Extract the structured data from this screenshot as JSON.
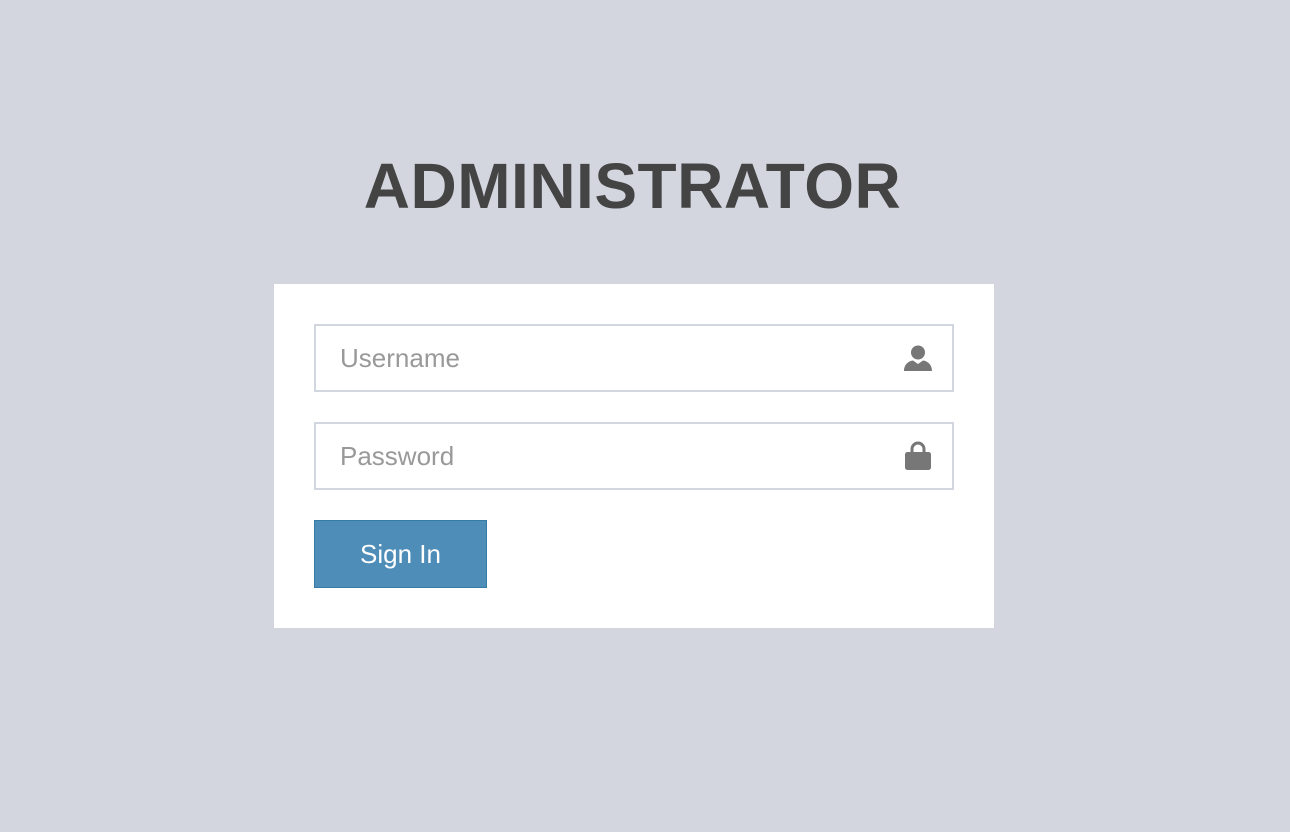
{
  "page": {
    "title": "ADMINISTRATOR"
  },
  "login": {
    "username": {
      "placeholder": "Username",
      "value": "",
      "icon": "user-icon"
    },
    "password": {
      "placeholder": "Password",
      "value": "",
      "icon": "lock-icon"
    },
    "signin_label": "Sign In"
  },
  "colors": {
    "background": "#d3d6de",
    "panel": "#ffffff",
    "title": "#444444",
    "button": "#4f8db9",
    "icon": "#777777"
  }
}
